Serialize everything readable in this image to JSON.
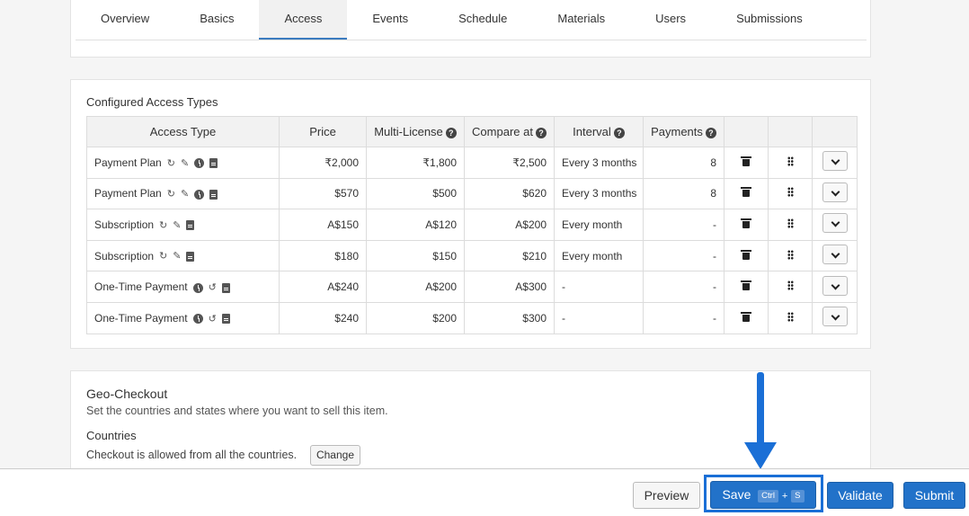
{
  "tabs": [
    "Overview",
    "Basics",
    "Access",
    "Events",
    "Schedule",
    "Materials",
    "Users",
    "Submissions"
  ],
  "active_tab": "Access",
  "access": {
    "title": "Configured Access Types",
    "headers": {
      "access_type": "Access Type",
      "price": "Price",
      "multi_license": "Multi-License",
      "compare_at": "Compare at",
      "interval": "Interval",
      "payments": "Payments"
    },
    "help_glyph": "?",
    "rows": [
      {
        "type": "Payment Plan",
        "icons": [
          "refresh-icon",
          "pencil-icon",
          "clock-icon",
          "document-icon"
        ],
        "price": "₹2,000",
        "multi": "₹1,800",
        "compare": "₹2,500",
        "interval": "Every 3 months",
        "payments": "8"
      },
      {
        "type": "Payment Plan",
        "icons": [
          "refresh-icon",
          "pencil-icon",
          "clock-icon",
          "document-icon"
        ],
        "price": "$570",
        "multi": "$500",
        "compare": "$620",
        "interval": "Every 3 months",
        "payments": "8"
      },
      {
        "type": "Subscription",
        "icons": [
          "refresh-icon",
          "pencil-icon",
          "document-icon"
        ],
        "price": "A$150",
        "multi": "A$120",
        "compare": "A$200",
        "interval": "Every month",
        "payments": "-"
      },
      {
        "type": "Subscription",
        "icons": [
          "refresh-icon",
          "pencil-icon",
          "document-icon"
        ],
        "price": "$180",
        "multi": "$150",
        "compare": "$210",
        "interval": "Every month",
        "payments": "-"
      },
      {
        "type": "One-Time Payment",
        "icons": [
          "clock-icon",
          "undo-icon",
          "document-icon"
        ],
        "price": "A$240",
        "multi": "A$200",
        "compare": "A$300",
        "interval": "-",
        "payments": "-"
      },
      {
        "type": "One-Time Payment",
        "icons": [
          "clock-icon",
          "undo-icon",
          "document-icon"
        ],
        "price": "$240",
        "multi": "$200",
        "compare": "$300",
        "interval": "-",
        "payments": "-"
      }
    ]
  },
  "geo": {
    "title": "Geo-Checkout",
    "description": "Set the countries and states where you want to sell this item.",
    "countries_label": "Countries",
    "allowed_text": "Checkout is allowed from all the countries.",
    "change_label": "Change"
  },
  "footer": {
    "preview_label": "Preview",
    "save_label": "Save",
    "save_shortcut_ctrl": "Ctrl",
    "save_shortcut_plus": "+",
    "save_shortcut_key": "S",
    "validate_label": "Validate",
    "submit_label": "Submit"
  },
  "colors": {
    "accent": "#2272c9",
    "highlight": "#1a6fd6"
  }
}
